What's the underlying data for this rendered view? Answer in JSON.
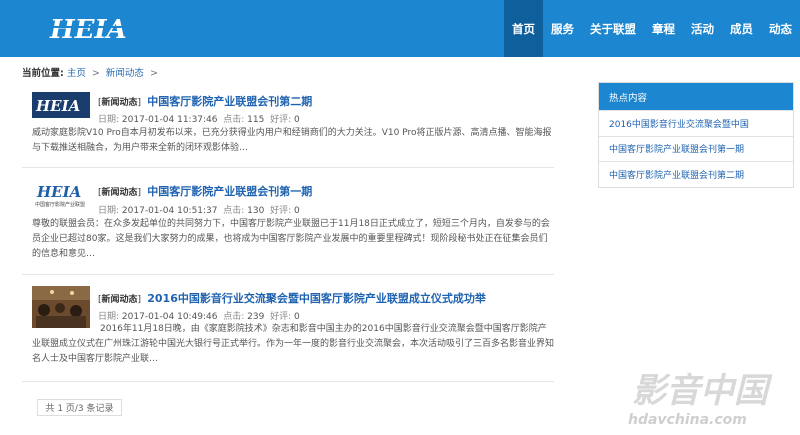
{
  "header": {
    "logo_text": "HEIA",
    "nav": [
      "首页",
      "服务",
      "关于联盟",
      "章程",
      "活动",
      "成员",
      "动态"
    ],
    "active_index": 0
  },
  "breadcrumb": {
    "label": "当前位置:",
    "home": "主页",
    "sep1": ">",
    "current": "新闻动态",
    "sep2": ">"
  },
  "articles": [
    {
      "category": "新闻动态",
      "title": "中国客厅影院产业联盟会刊第二期",
      "date_label": "日期:",
      "date": "2017-01-04 11:37:46",
      "views_label": "点击:",
      "views": "115",
      "comments_label": "好评:",
      "comments": "0",
      "excerpt": "威动家庭影院V10 Pro自本月初发布以来，已充分获得业内用户和经销商们的大力关注。V10 Pro将正版片源、高清点播、智能海报与下载推送相融合，为用户带来全新的闭环观影体验…",
      "thumb_icon": "heia-logo-thumbnail"
    },
    {
      "category": "新闻动态",
      "title": "中国客厅影院产业联盟会刊第一期",
      "date_label": "日期:",
      "date": "2017-01-04 10:51:37",
      "views_label": "点击:",
      "views": "130",
      "comments_label": "好评:",
      "comments": "0",
      "excerpt": "尊敬的联盟会员：在众多发起单位的共同努力下，中国客厅影院产业联盟已于11月18日正式成立了，短短三个月内，自发参与的会员企业已超过80家。这是我们大家努力的成果，也将成为中国客厅影院产业发展中的重要里程碑式！现阶段秘书处正在征集会员们的信息和意见…",
      "thumb_icon": "heia-logo-thumbnail",
      "thumb_caption": "中国客厅影院产业联盟"
    },
    {
      "category": "新闻动态",
      "title": "2016中国影音行业交流聚会暨中国客厅影院产业联盟成立仪式成功举",
      "date_label": "日期:",
      "date": "2017-01-04 10:49:46",
      "views_label": "点击:",
      "views": "239",
      "comments_label": "好评:",
      "comments": "0",
      "excerpt": "2016年11月18日晚，由《家庭影院技术》杂志和影音中国主办的2016中国影音行业交流聚会暨中国客厅影院产业联盟成立仪式在广州珠江游轮中国光大银行号正式举行。作为一年一度的影音行业交流聚会，本次活动吸引了三百多名影音业界知名人士及中国客厅影院产业联…",
      "thumb_icon": "event-photo-thumbnail"
    }
  ],
  "pagination": {
    "text": "共 1 页/3 条记录"
  },
  "sidebar": {
    "title": "热点内容",
    "items": [
      "2016中国影音行业交流聚会暨中国",
      "中国客厅影院产业联盟会刊第一期",
      "中国客厅影院产业联盟会刊第二期"
    ]
  },
  "watermark": {
    "big": "影音中国",
    "url": "hdavchina.com"
  },
  "colors": {
    "brand_blue": "#1d86d0",
    "nav_active": "#0e5f9c",
    "link_blue": "#1f63b0"
  }
}
